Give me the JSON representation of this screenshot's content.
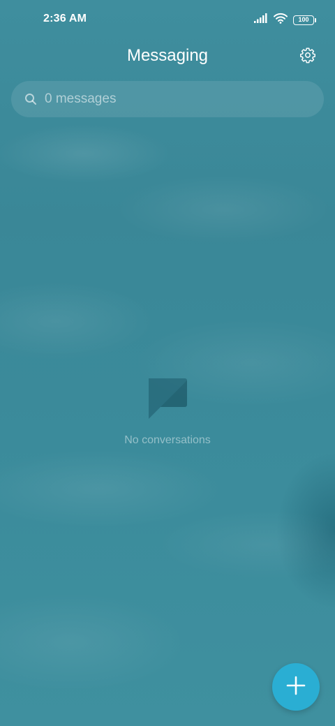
{
  "status_bar": {
    "time": "2:36 AM",
    "battery_level": "100",
    "icons": [
      "signal-icon",
      "wifi-icon",
      "battery-icon"
    ]
  },
  "header": {
    "title": "Messaging",
    "settings_icon": "gear-icon"
  },
  "search": {
    "placeholder": "0 messages",
    "value": "",
    "icon": "search-icon"
  },
  "empty_state": {
    "icon": "chat-bubble-icon",
    "text": "No conversations"
  },
  "fab": {
    "icon": "plus-icon"
  },
  "colors": {
    "background": "#3b8b9b",
    "fab": "#2aaed3",
    "text_primary": "#ffffff"
  }
}
